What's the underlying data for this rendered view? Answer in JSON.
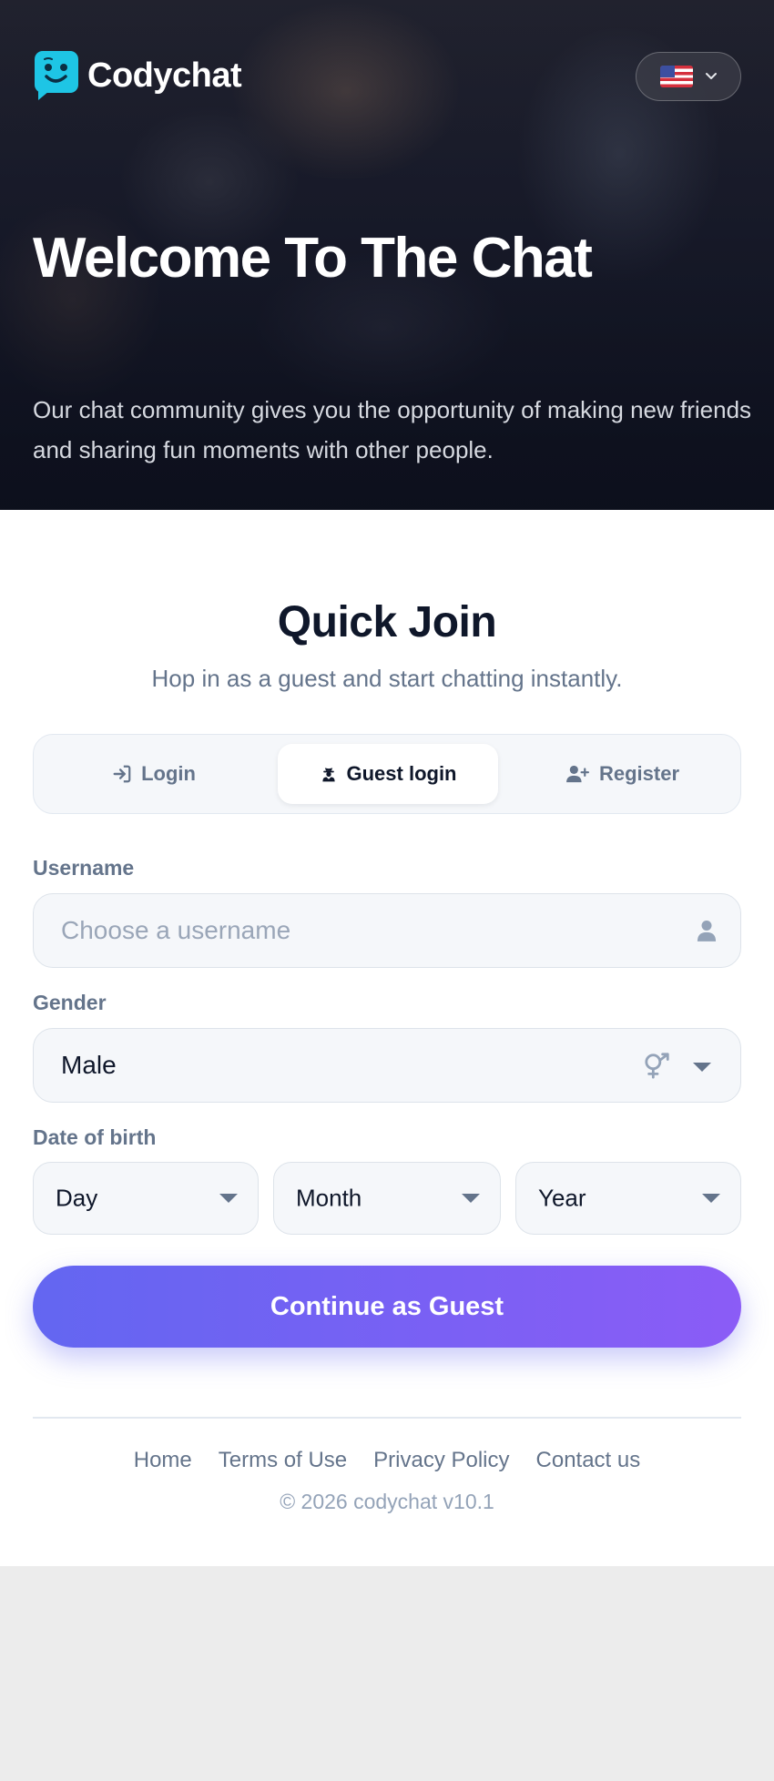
{
  "header": {
    "brand_name": "Codychat",
    "language_flag": "us-flag-icon",
    "hero_title": "Welcome To The Chat",
    "hero_subtitle": "Our chat community gives you the opportunity of making new friends and sharing fun moments with other people."
  },
  "quick_join": {
    "title": "Quick Join",
    "subtitle": "Hop in as a guest and start chatting instantly."
  },
  "tabs": [
    {
      "label": "Login",
      "icon": "sign-in-icon",
      "active": false
    },
    {
      "label": "Guest login",
      "icon": "user-secret-icon",
      "active": true
    },
    {
      "label": "Register",
      "icon": "user-plus-icon",
      "active": false
    }
  ],
  "form": {
    "username_label": "Username",
    "username_value": "",
    "username_placeholder": "Choose a username",
    "gender_label": "Gender",
    "gender_value": "Male",
    "dob_label": "Date of birth",
    "day_value": "Day",
    "month_value": "Month",
    "year_value": "Year",
    "submit_label": "Continue as Guest"
  },
  "footer": {
    "links": [
      "Home",
      "Terms of Use",
      "Privacy Policy",
      "Contact us"
    ],
    "copyright": "© 2026 codychat v10.1"
  },
  "colors": {
    "accent_start": "#6366f1",
    "accent_end": "#8b5cf6",
    "logo": "#1ec5e5"
  }
}
